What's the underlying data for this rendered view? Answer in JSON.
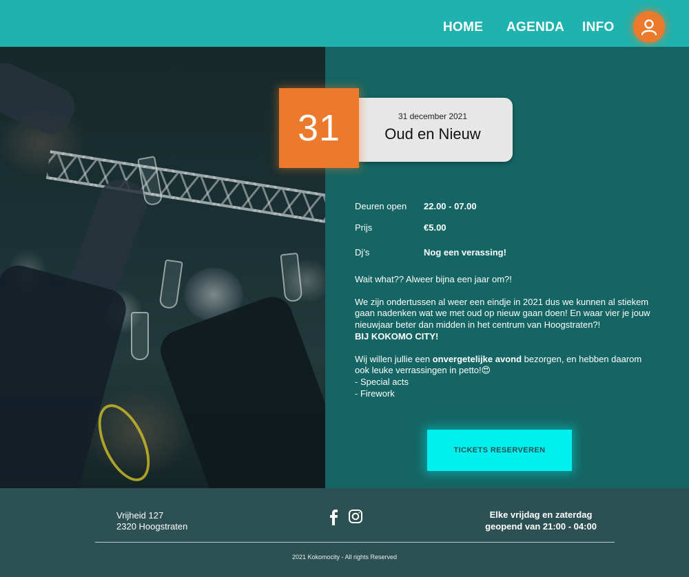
{
  "nav": {
    "items": [
      "HOME",
      "AGENDA",
      "INFO"
    ],
    "user_icon": "user-icon"
  },
  "event": {
    "day": "31",
    "date": "31 december 2021",
    "title": "Oud en Nieuw",
    "details": [
      {
        "label": "Deuren open",
        "value": "22.00 - 07.00"
      },
      {
        "label": "Prijs",
        "value": "€5.00"
      },
      {
        "label": "Dj’s",
        "value": "Nog een verassing!"
      }
    ],
    "description": {
      "intro": "Wait what?? Alweer bijna een jaar om?!",
      "para2": "We zijn ondertussen al weer een eindje in 2021 dus we kunnen al stiekem gaan nadenken wat we met oud op nieuw gaan doen! En waar vier je jouw nieuwjaar beter dan midden in het centrum van Hoogstraten?!",
      "para2_bold": "BIJ KOKOMO CITY!",
      "para3_pre": "Wij willen jullie een ",
      "para3_bold": "onvergetelijke avond",
      "para3_post": " bezorgen, en hebben daarom ook leuke verrassingen in petto!😍",
      "list": [
        "- Special acts",
        "- Firework"
      ]
    },
    "cta": "TICKETS RESERVEREN"
  },
  "footer": {
    "address_line1": "Vrijheid 127",
    "address_line2": "2320 Hoogstraten",
    "social_icons": [
      "facebook-icon",
      "instagram-icon"
    ],
    "hours_line1": "Elke vrijdag en zaterdag",
    "hours_line2": "geopend van 21:00 - 04:00",
    "copyright": "2021 Kokomocity - All rights Reserved"
  },
  "colors": {
    "header": "#20b2ae",
    "accent": "#ec7a2c",
    "content_bg": "#146563",
    "footer_bg": "#2d5152",
    "cta": "#00f0f0"
  }
}
